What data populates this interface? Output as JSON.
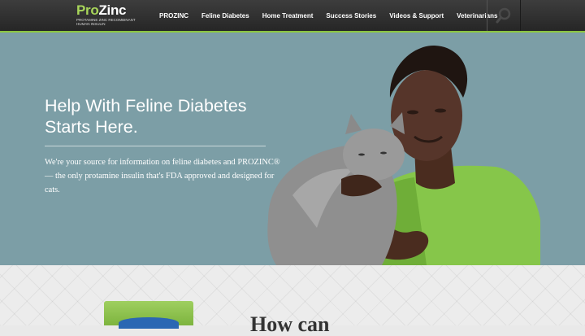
{
  "header": {
    "logo": {
      "pro": "Pro",
      "zinc": "Zinc",
      "tagline": "PROTAMINE ZINC RECOMBINANT HUMAN INSULIN"
    },
    "nav": [
      "PROZINC",
      "Feline Diabetes",
      "Home Treatment",
      "Success Stories",
      "Videos & Support",
      "Veterinarians"
    ],
    "search_icon": "search-icon"
  },
  "hero": {
    "title": "Help With Feline Diabetes Starts Here.",
    "description": "We're your source for information on feline diabetes and PROZINC® — the only protamine insulin that's FDA approved and designed for cats."
  },
  "section": {
    "heading": "How can"
  },
  "colors": {
    "accent": "#8cc63f",
    "hero_bg": "#7c9ea6",
    "nav_bg": "#2e2e2e"
  }
}
